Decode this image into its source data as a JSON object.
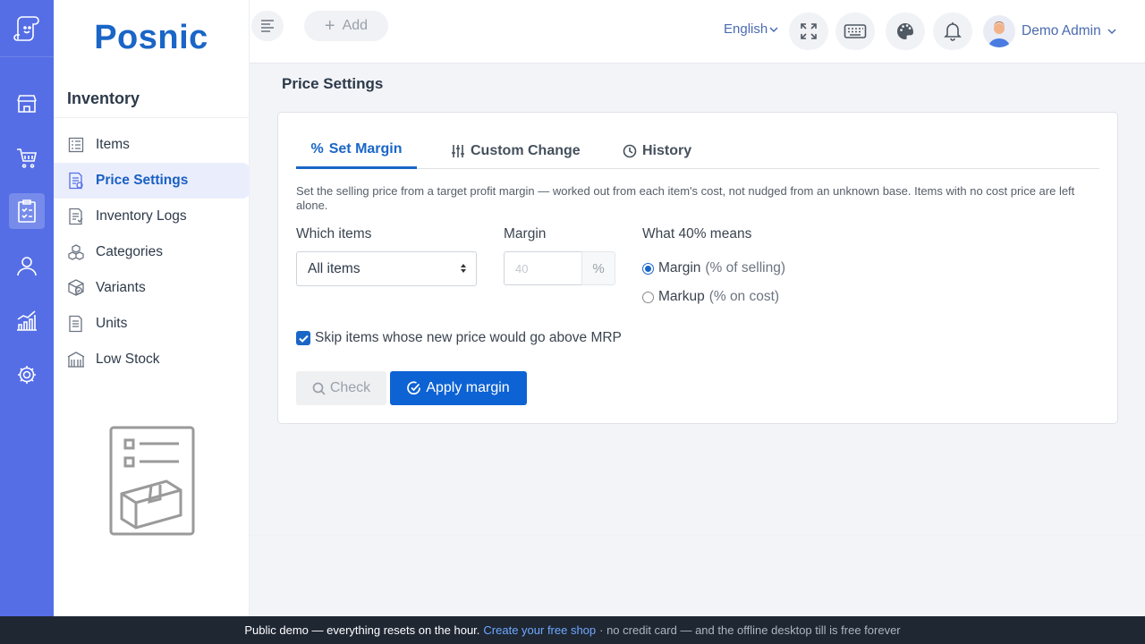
{
  "app": {
    "brand": "Posnic"
  },
  "topbar": {
    "add_label": "Add",
    "language": "English",
    "user_name": "Demo Admin"
  },
  "sidebar": {
    "section_title": "Inventory",
    "items": [
      {
        "label": "Items",
        "icon": "list-icon",
        "active": false
      },
      {
        "label": "Price Settings",
        "icon": "price-doc-icon",
        "active": true
      },
      {
        "label": "Inventory Logs",
        "icon": "log-doc-icon",
        "active": false
      },
      {
        "label": "Categories",
        "icon": "cubes-icon",
        "active": false
      },
      {
        "label": "Variants",
        "icon": "variant-box-icon",
        "active": false
      },
      {
        "label": "Units",
        "icon": "units-doc-icon",
        "active": false
      },
      {
        "label": "Low Stock",
        "icon": "warehouse-icon",
        "active": false
      }
    ]
  },
  "page": {
    "title": "Price Settings"
  },
  "tabs": [
    {
      "label": "Set Margin",
      "icon": "percent-icon",
      "active": true
    },
    {
      "label": "Custom Change",
      "icon": "sliders-icon",
      "active": false
    },
    {
      "label": "History",
      "icon": "clock-icon",
      "active": false
    }
  ],
  "form": {
    "description": "Set the selling price from a target profit margin — worked out from each item's cost, not nudged from an unknown base. Items with no cost price are left alone.",
    "which_items_label": "Which items",
    "which_items_value": "All items",
    "margin_label": "Margin",
    "margin_placeholder": "40",
    "margin_unit": "%",
    "meaning_label": "What 40% means",
    "option_margin": "Margin",
    "option_margin_hint": "(% of selling)",
    "option_markup": "Markup",
    "option_markup_hint": "(% on cost)",
    "selected_option": "margin",
    "skip_mrp_label": "Skip items whose new price would go above MRP",
    "skip_mrp_checked": true,
    "check_button": "Check",
    "apply_button": "Apply margin"
  },
  "footer": {
    "text": "Public demo — everything resets on the hour.",
    "link": "Create your free shop",
    "tail": "· no credit card — and the offline desktop till is free forever"
  },
  "colors": {
    "rail": "#556ee6",
    "brand": "#1a66c7",
    "primary_button": "#0d62d4",
    "footer_bg": "#1f2733"
  }
}
